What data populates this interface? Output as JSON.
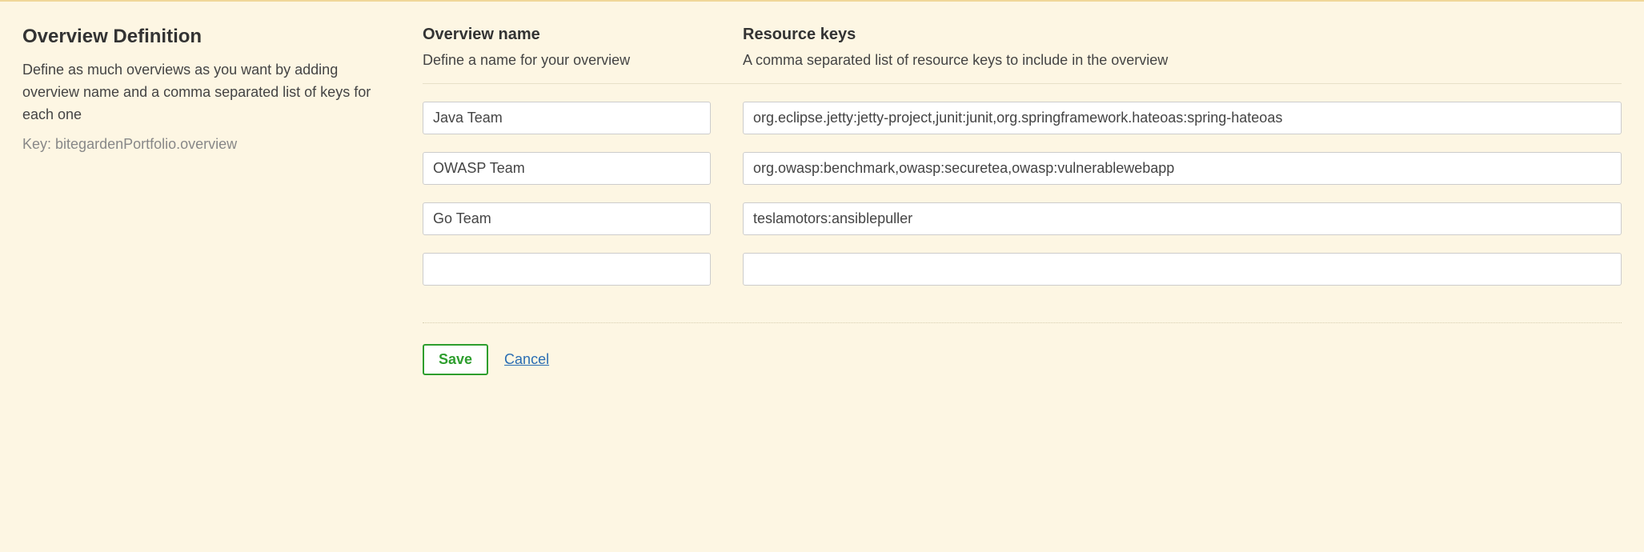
{
  "section": {
    "title": "Overview Definition",
    "description": "Define as much overviews as you want by adding overview name and a comma separated list of keys for each one",
    "key_prefix": "Key: ",
    "key_value": "bitegardenPortfolio.overview"
  },
  "columns": {
    "name": {
      "title": "Overview name",
      "desc": "Define a name for your overview"
    },
    "keys": {
      "title": "Resource keys",
      "desc": "A comma separated list of resource keys to include in the overview"
    }
  },
  "rows": [
    {
      "name": "Java Team",
      "keys": "org.eclipse.jetty:jetty-project,junit:junit,org.springframework.hateoas:spring-hateoas"
    },
    {
      "name": "OWASP Team",
      "keys": "org.owasp:benchmark,owasp:securetea,owasp:vulnerablewebapp"
    },
    {
      "name": "Go Team",
      "keys": "teslamotors:ansiblepuller"
    },
    {
      "name": "",
      "keys": ""
    }
  ],
  "actions": {
    "save": "Save",
    "cancel": "Cancel"
  }
}
